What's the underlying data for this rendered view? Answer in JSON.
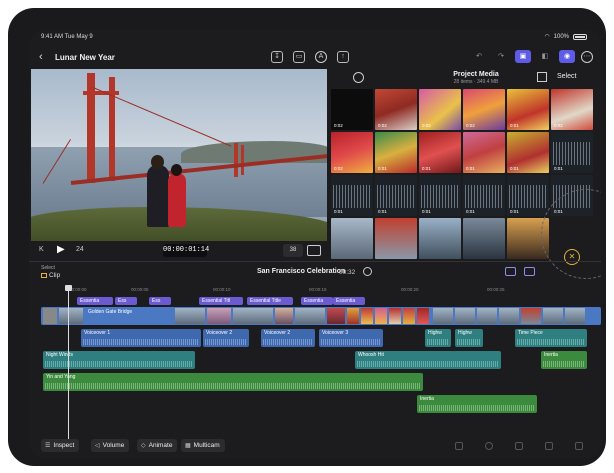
{
  "status": {
    "time": "9:41 AM  Tue May 9",
    "battery": "100%"
  },
  "toolbar": {
    "back": "‹",
    "title": "Lunar New Year"
  },
  "viewer": {
    "timecode": "00:00:01:14",
    "zoom": "38",
    "left_label": "K",
    "frames": "24"
  },
  "browser": {
    "title": "Project Media",
    "subtitle": "28 items · 349.4 MB",
    "select_label": "Select",
    "durations": [
      "0:02",
      "0:02",
      "0:02",
      "0:02",
      "0:01",
      "0:02",
      "0:02",
      "0:01",
      "0:01",
      "0:01",
      "0:01",
      "0:01",
      "0:01",
      "0:01",
      "0:01",
      "0:01",
      "0:01",
      "0:01"
    ]
  },
  "timeline": {
    "select_label": "Select",
    "clip_label": "Clip",
    "project_title": "San Francisco Celebration",
    "duration": "00:32",
    "ruler": [
      "00:00:00",
      "00:00:05",
      "00:00:10",
      "00:00:15",
      "00:00:20",
      "00:00:25"
    ],
    "titles": [
      "Essentia",
      "Ess",
      "Ess",
      "Essential Titl",
      "Essential Title",
      "Essentia",
      "Essentia"
    ],
    "video_clip": "Golden Gate Bridge",
    "voiceovers": [
      "Voiceover 1",
      "Voiceover 2",
      "Voiceover 2",
      "Voiceover 3"
    ],
    "music": [
      "Night Winds",
      "Whoosh Hit",
      "Highw",
      "Highw",
      "Time Piece",
      "Inertia"
    ],
    "soundtrack": [
      "Yin and Yang",
      "Inertia"
    ]
  },
  "bottom": {
    "inspect": "Inspect",
    "volume": "Volume",
    "animate": "Animate",
    "multicam": "Multicam"
  },
  "colors": {
    "accent": "#5e5ce6",
    "title_clip": "#6a5bd0",
    "video": "#4b78c2",
    "teal": "#2f7f80",
    "green": "#3c8a3e"
  }
}
